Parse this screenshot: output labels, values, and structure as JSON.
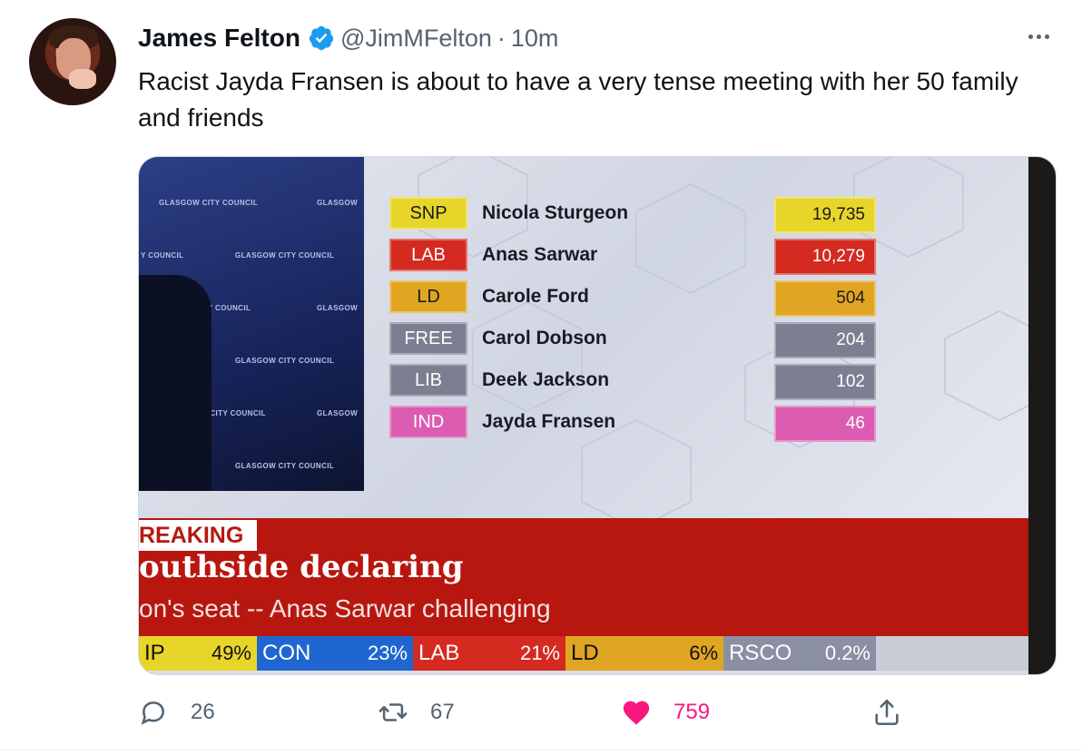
{
  "tweet": {
    "author_name": "James Felton",
    "handle": "@JimMFelton",
    "separator": "·",
    "time": "10m",
    "text": "Racist Jayda Fransen is about to have a very tense meeting with her 50 family and friends"
  },
  "media": {
    "results": [
      {
        "party": "SNP",
        "candidate": "Nicola Sturgeon",
        "votes": "19,735",
        "color": "#e8d52a",
        "text_color": "#1a1a1a"
      },
      {
        "party": "LAB",
        "candidate": "Anas Sarwar",
        "votes": "10,279",
        "color": "#d42a20",
        "text_color": "#ffffff"
      },
      {
        "party": "LD",
        "candidate": "Carole Ford",
        "votes": "504",
        "color": "#e0a623",
        "text_color": "#1a1a1a"
      },
      {
        "party": "FREE",
        "candidate": "Carol Dobson",
        "votes": "204",
        "color": "#7c7f92",
        "text_color": "#ffffff"
      },
      {
        "party": "LIB",
        "candidate": "Deek Jackson",
        "votes": "102",
        "color": "#7c7f92",
        "text_color": "#ffffff"
      },
      {
        "party": "IND",
        "candidate": "Jayda Fransen",
        "votes": "46",
        "color": "#dc5cb1",
        "text_color": "#ffffff"
      }
    ],
    "studio_logos": [
      "GLASGOW CITY COUNCIL",
      "GLASGOW",
      "Y COUNCIL",
      "GLASGOW CITY COUNCIL",
      "ASGOW CITY COUNCIL",
      "GLASGOW",
      "GLASGOW CITY COUNCIL",
      "V CITY COUNCIL",
      "GLASGOW",
      "GLASGOW CITY COUNCIL"
    ],
    "banner": {
      "tag": "REAKING",
      "headline": "outhside declaring",
      "subline": "on's seat -- Anas Sarwar challenging"
    },
    "ticker": [
      {
        "party": "IP",
        "pct": "49%",
        "color": "#e8d52a",
        "text_color": "#101010"
      },
      {
        "party": "CON",
        "pct": "23%",
        "color": "#1f66d1",
        "text_color": "#ffffff"
      },
      {
        "party": "LAB",
        "pct": "21%",
        "color": "#d42a20",
        "text_color": "#ffffff"
      },
      {
        "party": "LD",
        "pct": "6%",
        "color": "#e0a623",
        "text_color": "#101010"
      },
      {
        "party": "RSCO",
        "pct": "0.2%",
        "color": "#8a8fa3",
        "text_color": "#ffffff"
      }
    ]
  },
  "actions": {
    "replies": "26",
    "retweets": "67",
    "likes": "759"
  },
  "icons": {
    "verified": "verified-badge-icon",
    "more": "more-icon",
    "reply": "reply-icon",
    "retweet": "retweet-icon",
    "like": "heart-icon",
    "share": "share-icon"
  },
  "colors": {
    "accent": "#1d9bf0",
    "like": "#f91880",
    "secondary_text": "#536471"
  }
}
